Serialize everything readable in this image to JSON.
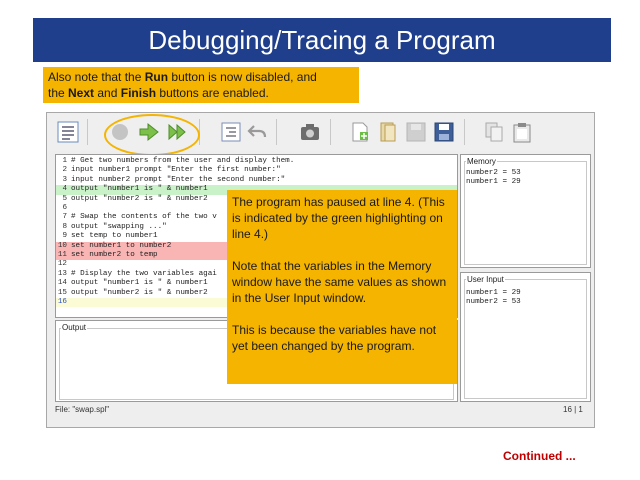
{
  "slide": {
    "title": "Debugging/Tracing a Program",
    "note_parts": [
      "Also note that the ",
      "Run",
      " button is now disabled, and ",
      "the ",
      "Next",
      " and ",
      "Finish",
      " buttons are enabled."
    ],
    "callout": [
      "The program has paused at line 4. (This is indicated by the green highlighting on line 4.)",
      "Note that the variables in the Memory window have the same values as shown in the User Input window.",
      "This is because the variables have not yet been changed by the program."
    ],
    "continued": "Continued ..."
  },
  "editor": {
    "lines": [
      {
        "n": "1",
        "text": "# Get two numbers from the user and display them.",
        "hl": ""
      },
      {
        "n": "2",
        "text": "input number1 prompt \"Enter the first number:\"",
        "hl": ""
      },
      {
        "n": "3",
        "text": "input number2 prompt \"Enter the second number:\"",
        "hl": ""
      },
      {
        "n": "4",
        "text": "output \"number1 is \" & number1",
        "hl": "green"
      },
      {
        "n": "5",
        "text": "output \"number2 is \" & number2",
        "hl": ""
      },
      {
        "n": "6",
        "text": "",
        "hl": ""
      },
      {
        "n": "7",
        "text": "# Swap the contents of the two v",
        "hl": ""
      },
      {
        "n": "8",
        "text": "output \"swapping ...\"",
        "hl": ""
      },
      {
        "n": "9",
        "text": "set temp to number1",
        "hl": ""
      },
      {
        "n": "10",
        "text": "set number1 to number2",
        "hl": "red"
      },
      {
        "n": "11",
        "text": "set number2 to temp",
        "hl": "red"
      },
      {
        "n": "12",
        "text": "",
        "hl": ""
      },
      {
        "n": "13",
        "text": "# Display the two variables agai",
        "hl": ""
      },
      {
        "n": "14",
        "text": "output \"number1 is \" & number1",
        "hl": ""
      },
      {
        "n": "15",
        "text": "output \"number2 is \" & number2",
        "hl": ""
      },
      {
        "n": "16",
        "text": "",
        "hl": "yellow"
      }
    ]
  },
  "panels": {
    "output_label": "Output",
    "memory_label": "Memory",
    "user_input_label": "User Input",
    "memory_vars": [
      "number2 = 53",
      "number1 = 29"
    ],
    "user_input_vars": [
      "number1 = 29",
      "number2 = 53"
    ]
  },
  "status": {
    "file": "File: \"swap.spl\"",
    "position": "16 | 1"
  },
  "colors": {
    "title_bg": "#1f3f8c",
    "note_bg": "#f4b400",
    "current_line": "#c9f2c9",
    "breakpoint_line": "#f9b4b4",
    "cursor_line": "#fbfbd6",
    "continued": "#c00000"
  }
}
